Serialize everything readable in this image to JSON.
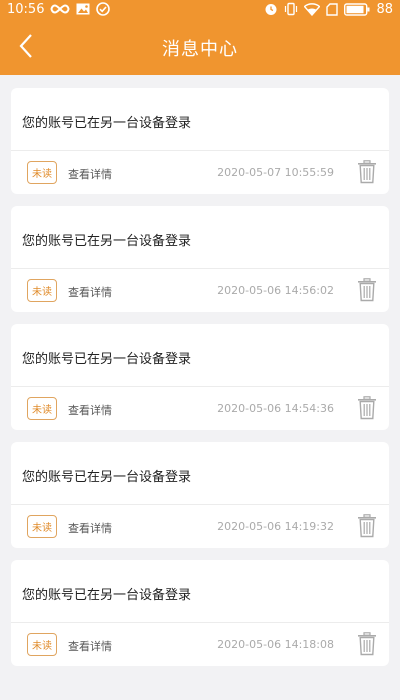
{
  "status_bar": {
    "time": "10:56",
    "battery": "88"
  },
  "header": {
    "title": "消息中心"
  },
  "messages": [
    {
      "title": "您的账号已在另一台设备登录",
      "badge": "未读",
      "detail_link": "查看详情",
      "time": "2020-05-07 10:55:59"
    },
    {
      "title": "您的账号已在另一台设备登录",
      "badge": "未读",
      "detail_link": "查看详情",
      "time": "2020-05-06 14:56:02"
    },
    {
      "title": "您的账号已在另一台设备登录",
      "badge": "未读",
      "detail_link": "查看详情",
      "time": "2020-05-06 14:54:36"
    },
    {
      "title": "您的账号已在另一台设备登录",
      "badge": "未读",
      "detail_link": "查看详情",
      "time": "2020-05-06 14:19:32"
    },
    {
      "title": "您的账号已在另一台设备登录",
      "badge": "未读",
      "detail_link": "查看详情",
      "time": "2020-05-06 14:18:08"
    }
  ],
  "colors": {
    "header_bg": "#f0952f",
    "page_bg": "#f2f2f4",
    "badge": "#e08b2a"
  }
}
